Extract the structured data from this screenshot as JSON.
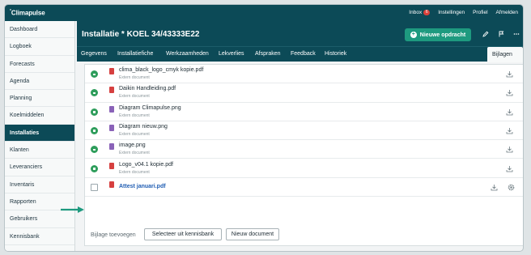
{
  "app": {
    "brand": "Climapulse"
  },
  "topnav": {
    "inbox": "Inbox",
    "inbox_count": "6",
    "settings": "Instellingen",
    "profile": "Profiel",
    "logout": "Afmelden"
  },
  "sidebar": {
    "items": [
      {
        "label": "Dashboard"
      },
      {
        "label": "Logboek"
      },
      {
        "label": "Forecasts"
      },
      {
        "label": "Agenda"
      },
      {
        "label": "Planning"
      },
      {
        "label": "Koelmiddelen"
      },
      {
        "label": "Installaties"
      },
      {
        "label": "Klanten"
      },
      {
        "label": "Leveranciers"
      },
      {
        "label": "Inventaris"
      },
      {
        "label": "Rapporten"
      },
      {
        "label": "Gebruikers"
      },
      {
        "label": "Kennisbank"
      }
    ],
    "active": "Installaties"
  },
  "header": {
    "title": "Installatie * KOEL 34/43333E22",
    "new_order_label": "Nieuwe opdracht"
  },
  "tabs": [
    {
      "label": "Gegevens"
    },
    {
      "label": "Installatiefiche"
    },
    {
      "label": "Werkzaamheden"
    },
    {
      "label": "Lekverlies"
    },
    {
      "label": "Afspraken"
    },
    {
      "label": "Feedback"
    },
    {
      "label": "Historiek"
    },
    {
      "label": "Bijlagen (7)"
    }
  ],
  "attachments": [
    {
      "name": "clima_black_logo_cmyk kopie.pdf",
      "sub": "Extern document",
      "type": "pdf"
    },
    {
      "name": "Daikin Handleiding.pdf",
      "sub": "Extern document",
      "type": "pdf"
    },
    {
      "name": "Diagram Climapulse.png",
      "sub": "Extern document",
      "type": "png"
    },
    {
      "name": "Diagram nieuw.png",
      "sub": "Extern document",
      "type": "png"
    },
    {
      "name": "image.png",
      "sub": "Extern document",
      "type": "png"
    },
    {
      "name": "Logo_v04.1 kopie.pdf",
      "sub": "Extern document",
      "type": "pdf"
    },
    {
      "name": "Attest januari.pdf",
      "sub": "",
      "type": "pdf"
    }
  ],
  "footer": {
    "label": "Bijlage toevoegen",
    "kb_button": "Selecteer uit kennisbank",
    "new_doc_button": "Nieuw document"
  },
  "colors": {
    "primary": "#0c4a57",
    "accent": "#1e9a7f",
    "status_ok": "#2e9d5b",
    "link": "#1f5db3"
  },
  "icons": {
    "edit": "pencil-icon",
    "flag": "flag-icon",
    "more": "more-icon",
    "download": "download-icon",
    "settings": "gear-icon"
  }
}
